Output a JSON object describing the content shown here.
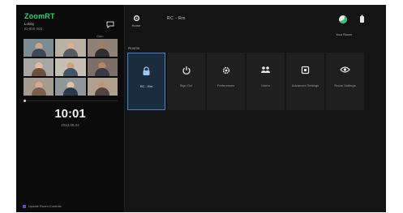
{
  "left": {
    "brand": "ZoomRT",
    "room_line1": "Lobby",
    "room_line2": "ID 000 000",
    "camera_label": "Cam",
    "clock": "10:01",
    "date": "2023.09.04",
    "update_label": "Update Room Controls",
    "video_progress": 0.0
  },
  "header": {
    "home_label": "Home",
    "room_name": "RC - Rm",
    "status_label": "Your Room"
  },
  "section_title": "Rooms",
  "tiles": [
    {
      "icon": "lock-icon",
      "label": "RC - Rm",
      "active": true
    },
    {
      "icon": "power-icon",
      "label": "Sign Out",
      "active": false
    },
    {
      "icon": "settings-icon",
      "label": "Preferences",
      "active": false
    },
    {
      "icon": "participants-icon",
      "label": "Users",
      "active": false
    },
    {
      "icon": "room-settings-icon",
      "label": "Advanced Settings",
      "active": false
    },
    {
      "icon": "view-icon",
      "label": "Room Settings",
      "active": false
    }
  ],
  "colors": {
    "brand": "#33d17a",
    "accent": "#3c84d6",
    "background": "#141414"
  }
}
